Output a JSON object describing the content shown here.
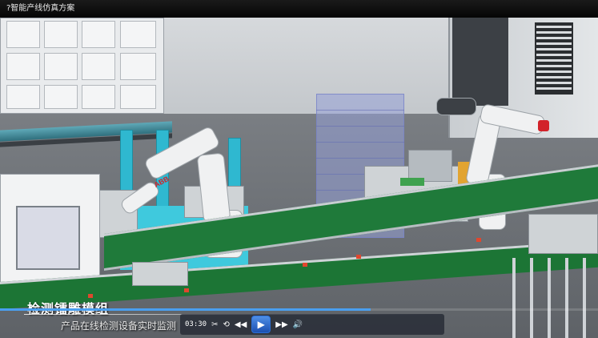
{
  "window": {
    "title": "?智能产线仿真方案"
  },
  "captions": {
    "main": "检测镭雕模组",
    "sub": "产品在线检测设备实时监测"
  },
  "player": {
    "current_time": "03:30",
    "progress_fraction": 0.62,
    "icons": [
      "cut-icon",
      "repeat-icon",
      "rewind-icon",
      "play-icon",
      "fast-forward-icon",
      "volume-icon"
    ],
    "accent_color": "#2b6fd6"
  },
  "scene": {
    "robot_brand": "ABB"
  }
}
